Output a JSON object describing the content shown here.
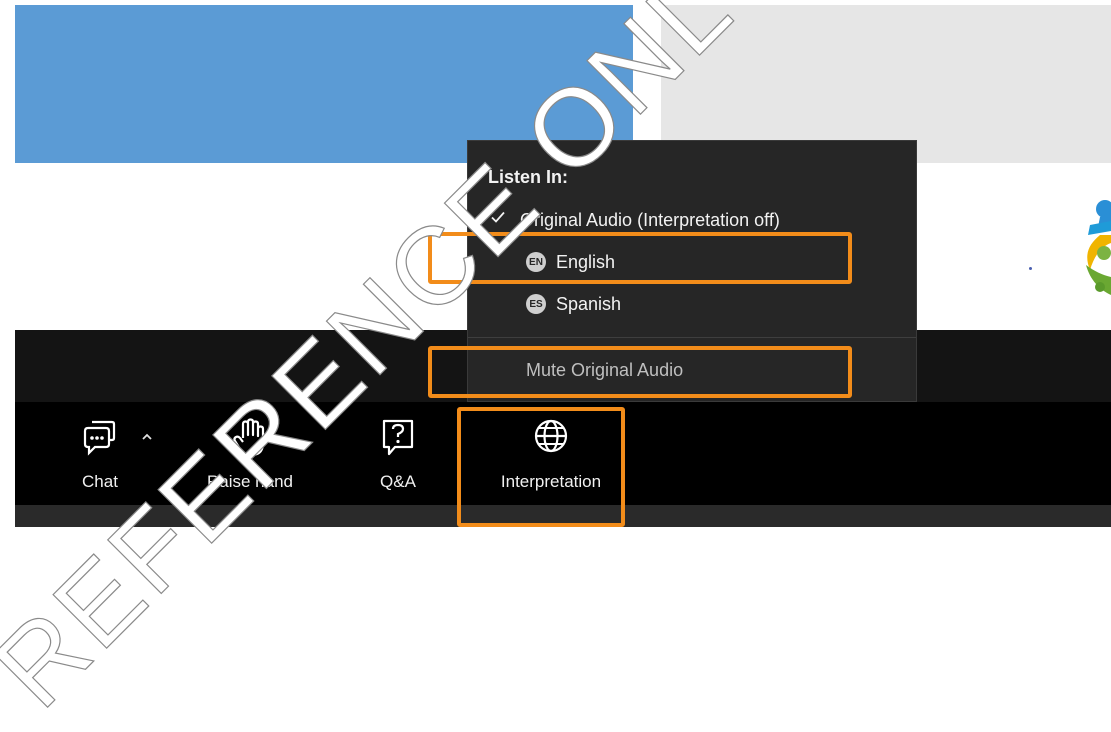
{
  "menu": {
    "title": "Listen In:",
    "items": [
      {
        "label": "Original Audio (Interpretation off)",
        "checked": true,
        "badge": ""
      },
      {
        "label": "English",
        "checked": false,
        "badge": "EN"
      },
      {
        "label": "Spanish",
        "checked": false,
        "badge": "ES"
      }
    ],
    "mute_label": "Mute Original Audio"
  },
  "toolbar": {
    "chat_label": "Chat",
    "raise_hand_label": "Raise hand",
    "qa_label": "Q&A",
    "interpretation_label": "Interpretation"
  },
  "watermark": "REFERENCE ONLY",
  "colors": {
    "highlight": "#f28c1a",
    "menu_bg": "#262626",
    "toolbar_bg": "#000000",
    "tile_blue": "#5b9bd5"
  }
}
